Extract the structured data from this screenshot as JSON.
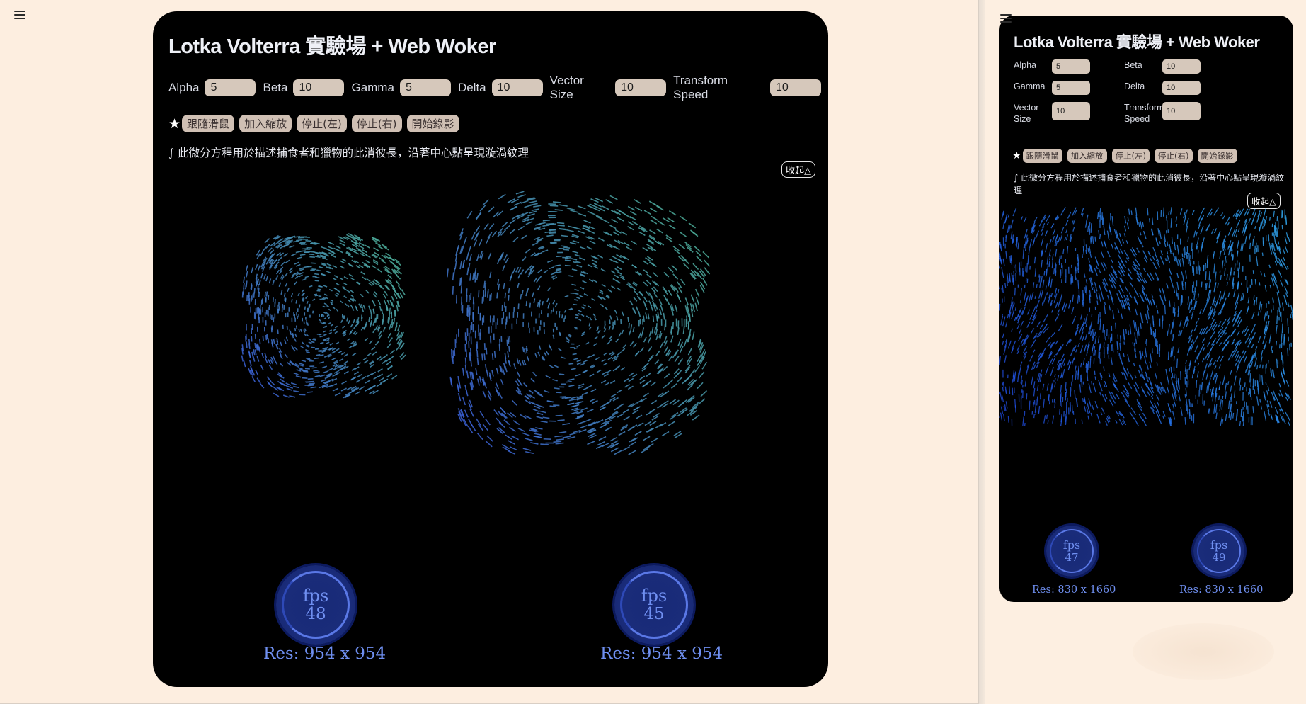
{
  "menu_icon": "hamburger-menu-icon",
  "colors": {
    "page_background": "#fdefe1",
    "card_background": "#000000",
    "input_background": "#d6c8bb",
    "fps_text": "#6f8ff0",
    "particle_start": "#3a5fd8",
    "particle_end": "#4fb39a"
  },
  "panels": [
    {
      "title": "Lotka Volterra 實驗場 + Web Woker",
      "params": [
        {
          "label": "Alpha",
          "value": "5"
        },
        {
          "label": "Beta",
          "value": "10"
        },
        {
          "label": "Gamma",
          "value": "5"
        },
        {
          "label": "Delta",
          "value": "10"
        },
        {
          "label": "Vector Size",
          "value": "10"
        },
        {
          "label": "Transform Speed",
          "value": "10"
        }
      ],
      "star": "★",
      "buttons": [
        "跟隨滑鼠",
        "加入縮放",
        "停止(左)",
        "停止(右)",
        "開始錄影"
      ],
      "description": "∫ 此微分方程用於描述捕食者和獵物的此消彼長，沿著中心點呈現漩渦紋理",
      "collapse_label": "收起△",
      "fps_label": "fps",
      "monitors": [
        {
          "fps": "48",
          "res": "Res: 954 x 954"
        },
        {
          "fps": "45",
          "res": "Res: 954 x 954"
        }
      ]
    },
    {
      "title": "Lotka Volterra 實驗場 + Web Woker",
      "params": [
        {
          "label": "Alpha",
          "value": "5"
        },
        {
          "label": "Beta",
          "value": "10"
        },
        {
          "label": "Gamma",
          "value": "5"
        },
        {
          "label": "Delta",
          "value": "10"
        },
        {
          "label": "Vector Size",
          "value": "10"
        },
        {
          "label": "Transform Speed",
          "value": "10"
        }
      ],
      "star": "★",
      "buttons": [
        "跟隨滑鼠",
        "加入縮放",
        "停止(左)",
        "停止(右)",
        "開始錄影"
      ],
      "description": "∫ 此微分方程用於描述捕食者和獵物的此消彼長，沿著中心點呈現漩渦紋理",
      "collapse_label": "收起△",
      "fps_label": "fps",
      "monitors": [
        {
          "fps": "47",
          "res": "Res: 830 x 1660"
        },
        {
          "fps": "49",
          "res": "Res: 830 x 1660"
        }
      ]
    }
  ]
}
